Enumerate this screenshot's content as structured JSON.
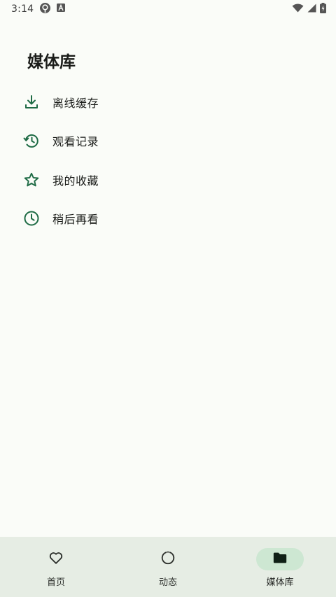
{
  "status_bar": {
    "time": "3:14"
  },
  "page": {
    "title": "媒体库"
  },
  "menu": {
    "items": [
      {
        "label": "离线缓存",
        "icon": "download-icon"
      },
      {
        "label": "观看记录",
        "icon": "history-icon"
      },
      {
        "label": "我的收藏",
        "icon": "star-outline-icon"
      },
      {
        "label": "稍后再看",
        "icon": "clock-icon"
      }
    ]
  },
  "bottom_nav": {
    "items": [
      {
        "label": "首页",
        "icon": "heart-outline-icon",
        "active": false
      },
      {
        "label": "动态",
        "icon": "dashed-circle-icon",
        "active": false
      },
      {
        "label": "媒体库",
        "icon": "folder-icon",
        "active": true
      }
    ]
  },
  "colors": {
    "background": "#fafcf8",
    "accent_icon": "#1e6b45",
    "nav_background": "#e6ede4",
    "nav_active_pill": "#cde7d2"
  }
}
